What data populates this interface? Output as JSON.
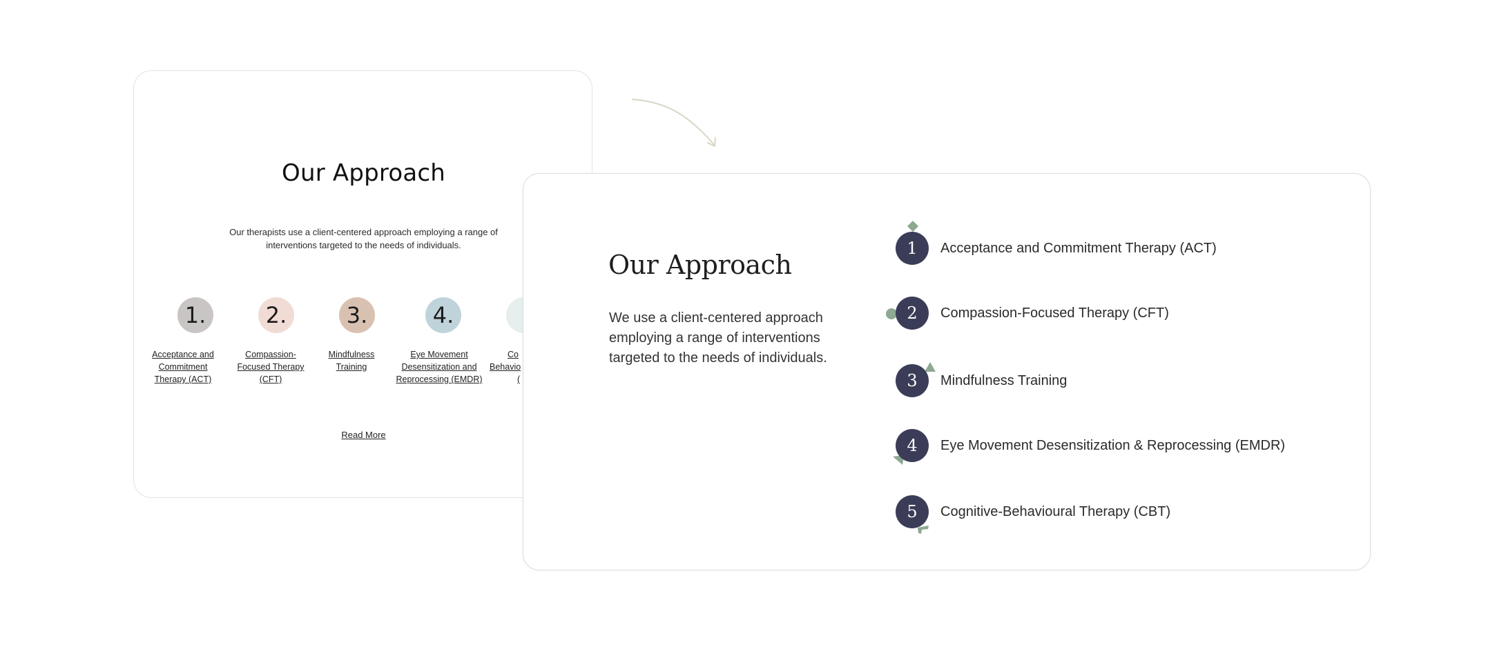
{
  "old_card": {
    "title": "Our Approach",
    "intro_line1": "Our therapists use a client-centered approach employing a range of",
    "intro_line2": "interventions targeted to the needs of individuals.",
    "items": [
      {
        "number": "1.",
        "line1": "Acceptance and",
        "line2": "Commitment",
        "line3": "Therapy (ACT)",
        "color": "#c9c5c5"
      },
      {
        "number": "2.",
        "line1": "Compassion-",
        "line2": "Focused Therapy",
        "line3": "(CFT)",
        "color": "#f1dcd5"
      },
      {
        "number": "3.",
        "line1": "Mindfulness",
        "line2": "Training",
        "line3": "",
        "color": "#d9c1b1"
      },
      {
        "number": "4.",
        "line1": "Eye Movement",
        "line2": "Desensitization and",
        "line3": "Reprocessing (EMDR)",
        "color": "#bfd3db"
      },
      {
        "number": "",
        "line1": "Co",
        "line2": "Behavio",
        "line3": "(",
        "color": "#e6eeee"
      }
    ],
    "read_more": "Read More"
  },
  "new_card": {
    "title": "Our Approach",
    "intro": "We use a client-centered approach employing a range of interventions targeted to the needs of individuals.",
    "circle_color": "#3b3d58",
    "accent_color": "#8ea891",
    "items": [
      {
        "number": "1",
        "label": "Acceptance and Commitment Therapy (ACT)"
      },
      {
        "number": "2",
        "label": "Compassion-Focused Therapy (CFT)"
      },
      {
        "number": "3",
        "label": "Mindfulness Training"
      },
      {
        "number": "4",
        "label": "Eye Movement Desensitization & Reprocessing (EMDR)"
      },
      {
        "number": "5",
        "label": "Cognitive-Behavioural Therapy (CBT)"
      }
    ]
  },
  "arrow_color": "#d9d6c6"
}
